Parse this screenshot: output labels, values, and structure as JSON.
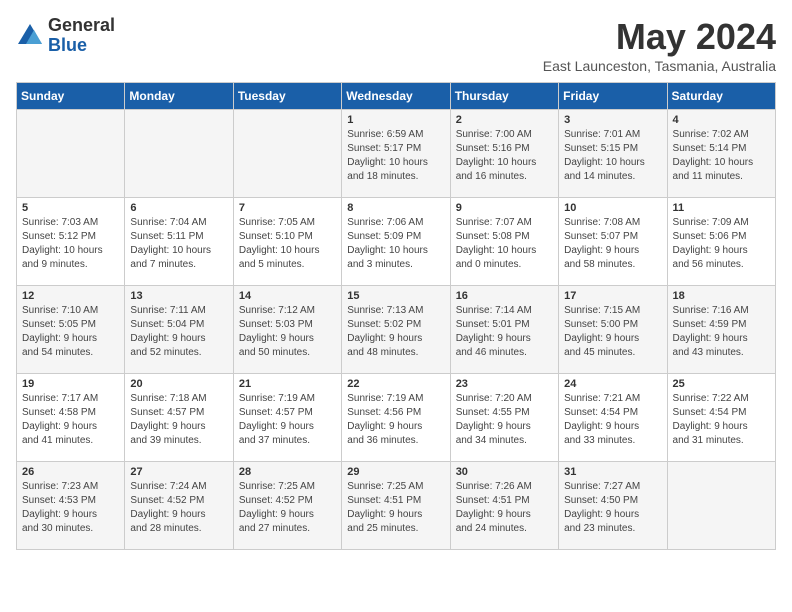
{
  "header": {
    "logo_general": "General",
    "logo_blue": "Blue",
    "month_title": "May 2024",
    "location": "East Launceston, Tasmania, Australia"
  },
  "days_of_week": [
    "Sunday",
    "Monday",
    "Tuesday",
    "Wednesday",
    "Thursday",
    "Friday",
    "Saturday"
  ],
  "weeks": [
    [
      {
        "day": "",
        "content": ""
      },
      {
        "day": "",
        "content": ""
      },
      {
        "day": "",
        "content": ""
      },
      {
        "day": "1",
        "content": "Sunrise: 6:59 AM\nSunset: 5:17 PM\nDaylight: 10 hours\nand 18 minutes."
      },
      {
        "day": "2",
        "content": "Sunrise: 7:00 AM\nSunset: 5:16 PM\nDaylight: 10 hours\nand 16 minutes."
      },
      {
        "day": "3",
        "content": "Sunrise: 7:01 AM\nSunset: 5:15 PM\nDaylight: 10 hours\nand 14 minutes."
      },
      {
        "day": "4",
        "content": "Sunrise: 7:02 AM\nSunset: 5:14 PM\nDaylight: 10 hours\nand 11 minutes."
      }
    ],
    [
      {
        "day": "5",
        "content": "Sunrise: 7:03 AM\nSunset: 5:12 PM\nDaylight: 10 hours\nand 9 minutes."
      },
      {
        "day": "6",
        "content": "Sunrise: 7:04 AM\nSunset: 5:11 PM\nDaylight: 10 hours\nand 7 minutes."
      },
      {
        "day": "7",
        "content": "Sunrise: 7:05 AM\nSunset: 5:10 PM\nDaylight: 10 hours\nand 5 minutes."
      },
      {
        "day": "8",
        "content": "Sunrise: 7:06 AM\nSunset: 5:09 PM\nDaylight: 10 hours\nand 3 minutes."
      },
      {
        "day": "9",
        "content": "Sunrise: 7:07 AM\nSunset: 5:08 PM\nDaylight: 10 hours\nand 0 minutes."
      },
      {
        "day": "10",
        "content": "Sunrise: 7:08 AM\nSunset: 5:07 PM\nDaylight: 9 hours\nand 58 minutes."
      },
      {
        "day": "11",
        "content": "Sunrise: 7:09 AM\nSunset: 5:06 PM\nDaylight: 9 hours\nand 56 minutes."
      }
    ],
    [
      {
        "day": "12",
        "content": "Sunrise: 7:10 AM\nSunset: 5:05 PM\nDaylight: 9 hours\nand 54 minutes."
      },
      {
        "day": "13",
        "content": "Sunrise: 7:11 AM\nSunset: 5:04 PM\nDaylight: 9 hours\nand 52 minutes."
      },
      {
        "day": "14",
        "content": "Sunrise: 7:12 AM\nSunset: 5:03 PM\nDaylight: 9 hours\nand 50 minutes."
      },
      {
        "day": "15",
        "content": "Sunrise: 7:13 AM\nSunset: 5:02 PM\nDaylight: 9 hours\nand 48 minutes."
      },
      {
        "day": "16",
        "content": "Sunrise: 7:14 AM\nSunset: 5:01 PM\nDaylight: 9 hours\nand 46 minutes."
      },
      {
        "day": "17",
        "content": "Sunrise: 7:15 AM\nSunset: 5:00 PM\nDaylight: 9 hours\nand 45 minutes."
      },
      {
        "day": "18",
        "content": "Sunrise: 7:16 AM\nSunset: 4:59 PM\nDaylight: 9 hours\nand 43 minutes."
      }
    ],
    [
      {
        "day": "19",
        "content": "Sunrise: 7:17 AM\nSunset: 4:58 PM\nDaylight: 9 hours\nand 41 minutes."
      },
      {
        "day": "20",
        "content": "Sunrise: 7:18 AM\nSunset: 4:57 PM\nDaylight: 9 hours\nand 39 minutes."
      },
      {
        "day": "21",
        "content": "Sunrise: 7:19 AM\nSunset: 4:57 PM\nDaylight: 9 hours\nand 37 minutes."
      },
      {
        "day": "22",
        "content": "Sunrise: 7:19 AM\nSunset: 4:56 PM\nDaylight: 9 hours\nand 36 minutes."
      },
      {
        "day": "23",
        "content": "Sunrise: 7:20 AM\nSunset: 4:55 PM\nDaylight: 9 hours\nand 34 minutes."
      },
      {
        "day": "24",
        "content": "Sunrise: 7:21 AM\nSunset: 4:54 PM\nDaylight: 9 hours\nand 33 minutes."
      },
      {
        "day": "25",
        "content": "Sunrise: 7:22 AM\nSunset: 4:54 PM\nDaylight: 9 hours\nand 31 minutes."
      }
    ],
    [
      {
        "day": "26",
        "content": "Sunrise: 7:23 AM\nSunset: 4:53 PM\nDaylight: 9 hours\nand 30 minutes."
      },
      {
        "day": "27",
        "content": "Sunrise: 7:24 AM\nSunset: 4:52 PM\nDaylight: 9 hours\nand 28 minutes."
      },
      {
        "day": "28",
        "content": "Sunrise: 7:25 AM\nSunset: 4:52 PM\nDaylight: 9 hours\nand 27 minutes."
      },
      {
        "day": "29",
        "content": "Sunrise: 7:25 AM\nSunset: 4:51 PM\nDaylight: 9 hours\nand 25 minutes."
      },
      {
        "day": "30",
        "content": "Sunrise: 7:26 AM\nSunset: 4:51 PM\nDaylight: 9 hours\nand 24 minutes."
      },
      {
        "day": "31",
        "content": "Sunrise: 7:27 AM\nSunset: 4:50 PM\nDaylight: 9 hours\nand 23 minutes."
      },
      {
        "day": "",
        "content": ""
      }
    ]
  ]
}
